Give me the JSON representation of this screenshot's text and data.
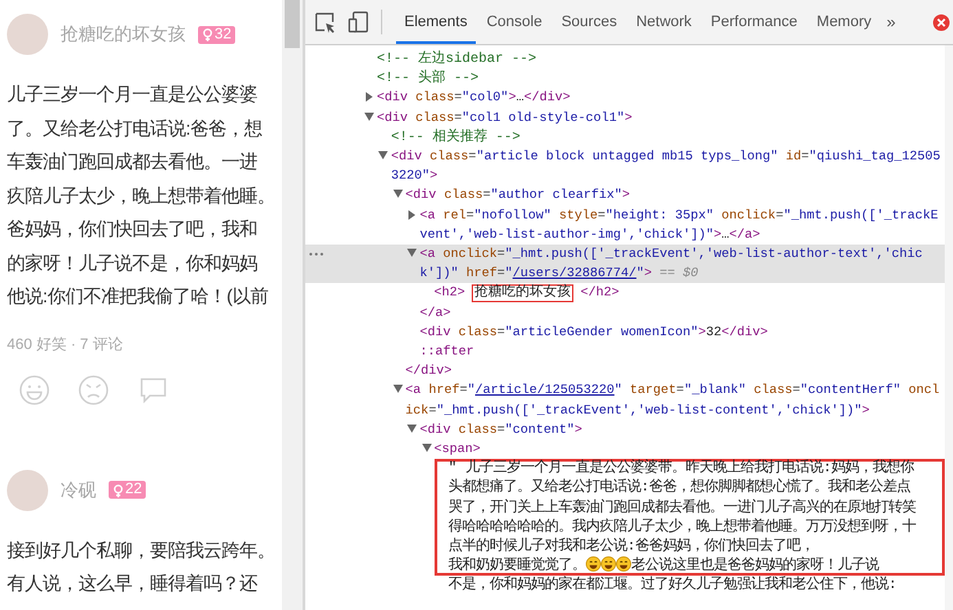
{
  "feed": {
    "posts": [
      {
        "author": "抢糖吃的坏女孩",
        "badge": "32",
        "lines": [
          "儿子三岁一个月一直是公公婆婆",
          "了。又给老公打电话说:爸爸，想",
          "车轰油门跑回成都去看他。一进",
          "疚陪儿子太少，晚上想带着他睡。",
          "爸妈妈，你们快回去了吧，我和",
          "的家呀！儿子说不是，你和妈妈",
          "他说:你们不准把我偷了哈！(以前"
        ],
        "stats": "460 好笑 · 7 评论"
      },
      {
        "author": "冷砚",
        "badge": "22",
        "lines": [
          "接到好几个私聊，要陪我云跨年。",
          "有人说，这么早，睡得着吗？还"
        ]
      }
    ]
  },
  "devtools": {
    "tabs": [
      {
        "label": "Elements",
        "selected": true
      },
      {
        "label": "Console",
        "selected": false
      },
      {
        "label": "Sources",
        "selected": false
      },
      {
        "label": "Network",
        "selected": false
      },
      {
        "label": "Performance",
        "selected": false
      },
      {
        "label": "Memory",
        "selected": false
      }
    ],
    "overflow": "»",
    "nodes": [
      {
        "kind": "line",
        "selected": false,
        "segments": [
          {
            "kind": "comment",
            "text": "<!-- 左边sidebar -->"
          }
        ]
      },
      {
        "kind": "line",
        "selected": false,
        "segments": [
          {
            "kind": "comment",
            "text": "<!-- 头部 -->"
          }
        ]
      },
      {
        "kind": "line",
        "selected": false,
        "expanded": false,
        "segments": [
          {
            "kind": "tag",
            "text": "<div"
          },
          {
            "kind": "attr",
            "text": " class"
          },
          {
            "kind": "punct",
            "text": "="
          },
          {
            "kind": "val",
            "text": "\"col0\""
          },
          {
            "kind": "tag",
            "text": ">"
          },
          {
            "kind": "text",
            "text": "…"
          },
          {
            "kind": "tag",
            "text": "</div>"
          }
        ]
      },
      {
        "kind": "line",
        "selected": false,
        "expanded": true,
        "segments": [
          {
            "kind": "tag",
            "text": "<div"
          },
          {
            "kind": "attr",
            "text": " class"
          },
          {
            "kind": "punct",
            "text": "="
          },
          {
            "kind": "val",
            "text": "\"col1 old-style-col1\""
          },
          {
            "kind": "tag",
            "text": ">"
          }
        ],
        "children": [
          {
            "kind": "line",
            "selected": false,
            "segments": [
              {
                "kind": "comment",
                "text": "<!-- 相关推荐 -->"
              }
            ]
          },
          {
            "kind": "line",
            "selected": false,
            "expanded": true,
            "segments": [
              {
                "kind": "tag",
                "text": "<div"
              },
              {
                "kind": "attr",
                "text": " class"
              },
              {
                "kind": "punct",
                "text": "="
              },
              {
                "kind": "val",
                "text": "\"article block untagged mb15 typs_long\""
              },
              {
                "kind": "attr",
                "text": " id"
              },
              {
                "kind": "punct",
                "text": "="
              },
              {
                "kind": "val",
                "text": "\"qiushi_tag_125053220\""
              },
              {
                "kind": "tag",
                "text": ">"
              }
            ],
            "children": [
              {
                "kind": "line",
                "selected": false,
                "expanded": true,
                "segments": [
                  {
                    "kind": "tag",
                    "text": "<div"
                  },
                  {
                    "kind": "attr",
                    "text": " class"
                  },
                  {
                    "kind": "punct",
                    "text": "="
                  },
                  {
                    "kind": "val",
                    "text": "\"author clearfix\""
                  },
                  {
                    "kind": "tag",
                    "text": ">"
                  }
                ],
                "children": [
                  {
                    "kind": "line",
                    "selected": false,
                    "expanded": false,
                    "segments": [
                      {
                        "kind": "tag",
                        "text": "<a"
                      },
                      {
                        "kind": "attr",
                        "text": " rel"
                      },
                      {
                        "kind": "punct",
                        "text": "="
                      },
                      {
                        "kind": "val",
                        "text": "\"nofollow\""
                      },
                      {
                        "kind": "attr",
                        "text": " style"
                      },
                      {
                        "kind": "punct",
                        "text": "="
                      },
                      {
                        "kind": "val",
                        "text": "\"height: 35px\""
                      },
                      {
                        "kind": "attr",
                        "text": " onclick"
                      },
                      {
                        "kind": "punct",
                        "text": "="
                      },
                      {
                        "kind": "val",
                        "text": "\"_hmt.push(['_trackEvent','web-list-author-img','chick'])\""
                      },
                      {
                        "kind": "tag",
                        "text": ">"
                      },
                      {
                        "kind": "text",
                        "text": "…"
                      },
                      {
                        "kind": "tag",
                        "text": "</a>"
                      }
                    ]
                  },
                  {
                    "kind": "line",
                    "selected": true,
                    "expanded": true,
                    "segments": [
                      {
                        "kind": "tag",
                        "text": "<a"
                      },
                      {
                        "kind": "attr",
                        "text": " onclick"
                      },
                      {
                        "kind": "punct",
                        "text": "="
                      },
                      {
                        "kind": "val",
                        "text": "\"_hmt.push(['_trackEvent','web-list-author-text','chick'])\""
                      },
                      {
                        "kind": "attr",
                        "text": " href"
                      },
                      {
                        "kind": "punct",
                        "text": "="
                      },
                      {
                        "kind": "val",
                        "text": "\""
                      },
                      {
                        "kind": "link",
                        "text": "/users/32886774/"
                      },
                      {
                        "kind": "val",
                        "text": "\""
                      },
                      {
                        "kind": "tag",
                        "text": ">"
                      },
                      {
                        "kind": "eq",
                        "text": " == $0"
                      }
                    ],
                    "children": [
                      {
                        "kind": "line",
                        "selected": false,
                        "segments": [
                          {
                            "kind": "tag",
                            "text": "<h2>"
                          },
                          {
                            "kind": "highlight",
                            "text": "抢糖吃的坏女孩"
                          },
                          {
                            "kind": "tag",
                            "text": "</h2>"
                          }
                        ]
                      }
                    ],
                    "closing": [
                      {
                        "kind": "tag",
                        "text": "</a>"
                      }
                    ]
                  },
                  {
                    "kind": "line",
                    "selected": false,
                    "segments": [
                      {
                        "kind": "tag",
                        "text": "<div"
                      },
                      {
                        "kind": "attr",
                        "text": " class"
                      },
                      {
                        "kind": "punct",
                        "text": "="
                      },
                      {
                        "kind": "val",
                        "text": "\"articleGender womenIcon\""
                      },
                      {
                        "kind": "tag",
                        "text": ">"
                      },
                      {
                        "kind": "text",
                        "text": "32"
                      },
                      {
                        "kind": "tag",
                        "text": "</div>"
                      }
                    ]
                  },
                  {
                    "kind": "line",
                    "selected": false,
                    "segments": [
                      {
                        "kind": "tag",
                        "text": "::after"
                      }
                    ]
                  }
                ],
                "closing": [
                  {
                    "kind": "tag",
                    "text": "</div>"
                  }
                ]
              },
              {
                "kind": "line",
                "selected": false,
                "expanded": true,
                "segments": [
                  {
                    "kind": "tag",
                    "text": "<a"
                  },
                  {
                    "kind": "attr",
                    "text": " href"
                  },
                  {
                    "kind": "punct",
                    "text": "="
                  },
                  {
                    "kind": "val",
                    "text": "\""
                  },
                  {
                    "kind": "link",
                    "text": "/article/125053220"
                  },
                  {
                    "kind": "val",
                    "text": "\""
                  },
                  {
                    "kind": "attr",
                    "text": " target"
                  },
                  {
                    "kind": "punct",
                    "text": "="
                  },
                  {
                    "kind": "val",
                    "text": "\"_blank\""
                  },
                  {
                    "kind": "attr",
                    "text": " class"
                  },
                  {
                    "kind": "punct",
                    "text": "="
                  },
                  {
                    "kind": "val",
                    "text": "\"contentHerf\""
                  },
                  {
                    "kind": "attr",
                    "text": " onclick"
                  },
                  {
                    "kind": "punct",
                    "text": "="
                  },
                  {
                    "kind": "val",
                    "text": "\"_hmt.push(['_trackEvent','web-list-content','chick'])\""
                  },
                  {
                    "kind": "tag",
                    "text": ">"
                  }
                ],
                "children": [
                  {
                    "kind": "line",
                    "selected": false,
                    "expanded": true,
                    "segments": [
                      {
                        "kind": "tag",
                        "text": "<div"
                      },
                      {
                        "kind": "attr",
                        "text": " class"
                      },
                      {
                        "kind": "punct",
                        "text": "="
                      },
                      {
                        "kind": "val",
                        "text": "\"content\""
                      },
                      {
                        "kind": "tag",
                        "text": ">"
                      }
                    ],
                    "children": [
                      {
                        "kind": "line",
                        "selected": false,
                        "expanded": true,
                        "segments": [
                          {
                            "kind": "tag",
                            "text": "<span>"
                          }
                        ],
                        "children": [
                          {
                            "kind": "text",
                            "selected": false,
                            "blocks": [
                              {
                                "highlighted": true,
                                "parts": [
                                  {
                                    "kind": "text",
                                    "text": "\" 儿子三岁一个月一直是公公婆婆带。昨天晚上给我打电话说:妈妈，我想你头都想痛了。又给老公打电话说:爸爸，想你脚脚都想心慌了。我和老公差点哭了，开门关上上车轰油门跑回成都去看他。一进门儿子高兴的在原地打转笑得哈哈哈哈哈哈的。我内疚陪儿子太少，晚上想带着他睡。万万没想到呀，十点半的时候儿子对我和老公说:爸爸妈妈，你们快回去了吧，"
                                  },
                                  {
                                    "kind": "text",
                                    "text": "我和奶奶要睡觉觉了。"
                                  },
                                  {
                                    "kind": "emoji"
                                  },
                                  {
                                    "kind": "emoji"
                                  },
                                  {
                                    "kind": "emoji"
                                  },
                                  {
                                    "kind": "text",
                                    "text": "老公说这里也是爸爸妈妈的家呀！儿子说"
                                  }
                                ]
                              },
                              {
                                "highlighted": false,
                                "parts": [
                                  {
                                    "kind": "text",
                                    "text": "不是，你和妈妈的家在都江堰。过了好久儿子勉强让我和老公住下，他说:"
                                  }
                                ]
                              }
                            ]
                          }
                        ]
                      }
                    ]
                  }
                ]
              }
            ]
          }
        ]
      }
    ]
  }
}
